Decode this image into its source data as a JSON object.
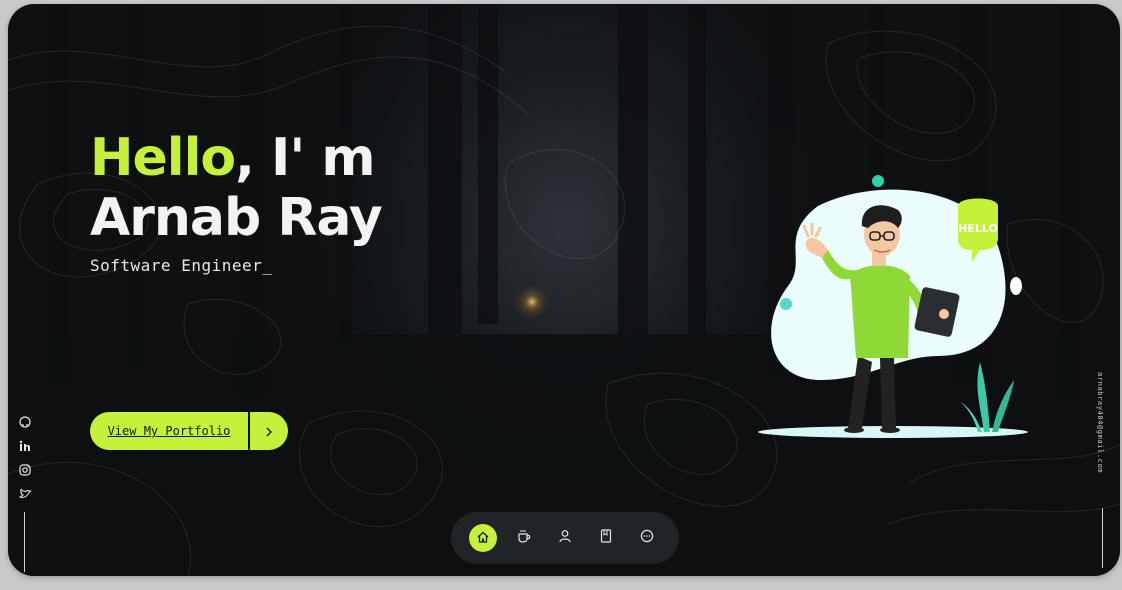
{
  "hero": {
    "greeting_highlight": "Hello",
    "greeting_rest": ", I' m",
    "name": "Arnab Ray",
    "role": "Software Engineer_"
  },
  "cta": {
    "label": "View My Portfolio",
    "arrow_icon": "chevron-right-icon"
  },
  "illustration": {
    "speech_bubble": "HELLO"
  },
  "social": [
    "github-icon",
    "linkedin-icon",
    "instagram-icon",
    "twitter-icon"
  ],
  "contact": {
    "email": "arnabray404@gmail.com"
  },
  "dock": {
    "items": [
      "home-icon",
      "coffee-icon",
      "user-icon",
      "book-icon",
      "chat-icon"
    ],
    "active": "home-icon"
  },
  "colors": {
    "accent": "#c5f13a",
    "background": "#14171a",
    "text": "#f3f3f3"
  }
}
